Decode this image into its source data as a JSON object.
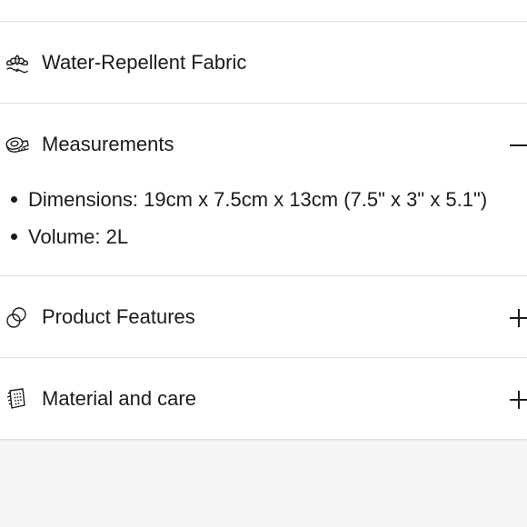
{
  "accordion": {
    "items": [
      {
        "label": "Water-Repellent Fabric",
        "icon": "water-lotus-icon",
        "state": "none"
      },
      {
        "label": "Measurements",
        "icon": "measuring-tape-icon",
        "state": "expanded"
      },
      {
        "label": "Product Features",
        "icon": "features-circles-icon",
        "state": "collapsed"
      },
      {
        "label": "Material and care",
        "icon": "care-label-icon",
        "state": "collapsed"
      }
    ],
    "measurements": {
      "bullets": [
        "Dimensions: 19cm x 7.5cm x 13cm (7.5\" x 3\" x 5.1\")",
        "Volume: 2L"
      ]
    }
  },
  "colors": {
    "text": "#1b1b1b",
    "divider": "#dedede",
    "panel": "#ffffff",
    "page": "#f5f5f6"
  }
}
